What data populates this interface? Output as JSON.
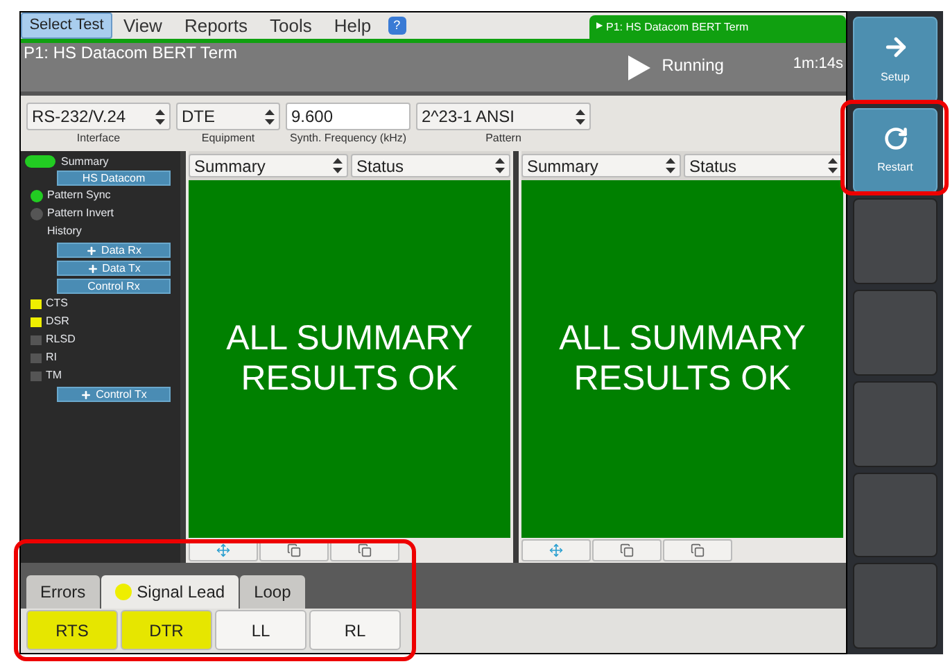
{
  "menu": {
    "items": [
      {
        "label": "Select Test",
        "selected": true
      },
      {
        "label": "View",
        "selected": false
      },
      {
        "label": "Reports",
        "selected": false
      },
      {
        "label": "Tools",
        "selected": false
      },
      {
        "label": "Help",
        "selected": false
      }
    ],
    "help_icon": "?",
    "test_tab_marker": "▶",
    "test_tab": "P1: HS Datacom BERT Term"
  },
  "title_bar": {
    "title": "P1: HS Datacom BERT Term",
    "status": "Running",
    "elapsed": "1m:14s"
  },
  "config": [
    {
      "kind": "select",
      "value": "RS-232/V.24",
      "label": "Interface"
    },
    {
      "kind": "select",
      "value": "DTE",
      "label": "Equipment"
    },
    {
      "kind": "input",
      "value": "9.600",
      "label": "Synth. Frequency (kHz)"
    },
    {
      "kind": "select",
      "value": "2^23-1 ANSI",
      "label": "Pattern"
    }
  ],
  "sidebar": {
    "summary": {
      "label": "Summary",
      "color": "#22cc22"
    },
    "groups": [
      {
        "label": "HS Datacom",
        "expandable": false,
        "items": [
          {
            "label": "Pattern Sync",
            "kind": "led",
            "color": "#22cc22"
          },
          {
            "label": "Pattern Invert",
            "kind": "led",
            "color": "#555555"
          },
          {
            "label": "History",
            "kind": "plain"
          }
        ]
      },
      {
        "label": "Data Rx",
        "expandable": true
      },
      {
        "label": "Data Tx",
        "expandable": true
      },
      {
        "label": "Control Rx",
        "expandable": false,
        "items": [
          {
            "label": "CTS",
            "kind": "square",
            "color": "#eeee00"
          },
          {
            "label": "DSR",
            "kind": "square",
            "color": "#eeee00"
          },
          {
            "label": "RLSD",
            "kind": "square",
            "color": "#555555"
          },
          {
            "label": "RI",
            "kind": "square",
            "color": "#555555"
          },
          {
            "label": "TM",
            "kind": "square",
            "color": "#555555"
          }
        ]
      },
      {
        "label": "Control Tx",
        "expandable": true
      }
    ]
  },
  "panels": [
    {
      "selectors": [
        "Summary",
        "Status"
      ],
      "message": "ALL SUMMARY RESULTS OK"
    },
    {
      "selectors": [
        "Summary",
        "Status"
      ],
      "message": "ALL SUMMARY RESULTS OK"
    }
  ],
  "bottom_tabs": [
    {
      "label": "Errors",
      "selected": false
    },
    {
      "label": "Signal Lead",
      "selected": true,
      "color": "#eeee00"
    },
    {
      "label": "Loop",
      "selected": false
    }
  ],
  "lead_buttons": [
    {
      "label": "RTS",
      "on": true
    },
    {
      "label": "DTR",
      "on": true
    },
    {
      "label": "LL",
      "on": false
    },
    {
      "label": "RL",
      "on": false
    }
  ],
  "side_buttons": [
    {
      "kind": "setup",
      "label": "Setup"
    },
    {
      "kind": "restart",
      "label": "Restart"
    },
    {
      "kind": "empty"
    },
    {
      "kind": "empty"
    },
    {
      "kind": "empty"
    },
    {
      "kind": "empty"
    },
    {
      "kind": "empty"
    }
  ]
}
